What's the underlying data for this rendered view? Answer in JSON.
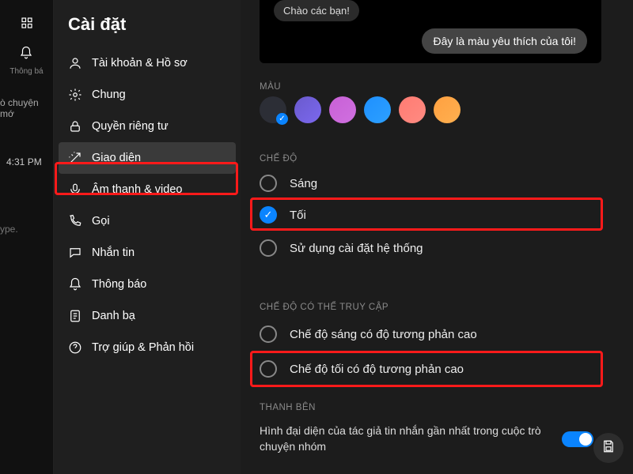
{
  "leftbar": {
    "notify_label": "Thông bá",
    "chat_text": "ò chuyện mớ",
    "time": "4:31 PM",
    "ype": "ype."
  },
  "settings": {
    "title": "Cài đặt",
    "items": [
      {
        "label": "Tài khoản & Hồ sơ",
        "icon": "person"
      },
      {
        "label": "Chung",
        "icon": "gear"
      },
      {
        "label": "Quyền riêng tư",
        "icon": "lock"
      },
      {
        "label": "Giao diện",
        "icon": "wand",
        "active": true
      },
      {
        "label": "Âm thanh & video",
        "icon": "mic"
      },
      {
        "label": "Gọi",
        "icon": "phone"
      },
      {
        "label": "Nhắn tin",
        "icon": "chat"
      },
      {
        "label": "Thông báo",
        "icon": "bell"
      },
      {
        "label": "Danh bạ",
        "icon": "contacts"
      },
      {
        "label": "Trợ giúp & Phản hồi",
        "icon": "help"
      }
    ]
  },
  "preview": {
    "left_bubble": "Chào các bạn!",
    "right_bubble": "Đây là màu yêu thích của tôi!"
  },
  "section_labels": {
    "color": "MÀU",
    "mode": "CHẾ ĐỘ",
    "accessible": "CHẾ ĐỘ CÓ THỂ TRUY CẬP",
    "sidebar": "THANH BÊN"
  },
  "colors": [
    {
      "hex": "#2c2e36",
      "selected": true
    },
    {
      "hex": "linear-gradient(135deg,#6a5acd,#7b68ee)"
    },
    {
      "hex": "linear-gradient(135deg,#c860d6,#d070e0)"
    },
    {
      "hex": "linear-gradient(135deg,#1e90ff,#2da0ff)"
    },
    {
      "hex": "linear-gradient(135deg,#ff7b72,#ff8b82)"
    },
    {
      "hex": "linear-gradient(135deg,#ffa040,#ffb050)"
    }
  ],
  "modes": [
    {
      "label": "Sáng",
      "selected": false
    },
    {
      "label": "Tối",
      "selected": true
    },
    {
      "label": "Sử dụng cài đặt hệ thống",
      "selected": false
    }
  ],
  "accessible_modes": [
    {
      "label": "Chế độ sáng có độ tương phản cao",
      "selected": false
    },
    {
      "label": "Chế độ tối có độ tương phản cao",
      "selected": false
    }
  ],
  "sidebar_setting": {
    "text": "Hình đại diện của tác giả tin nhắn gần nhất trong cuộc trò chuyện nhóm",
    "toggle_on": true
  }
}
